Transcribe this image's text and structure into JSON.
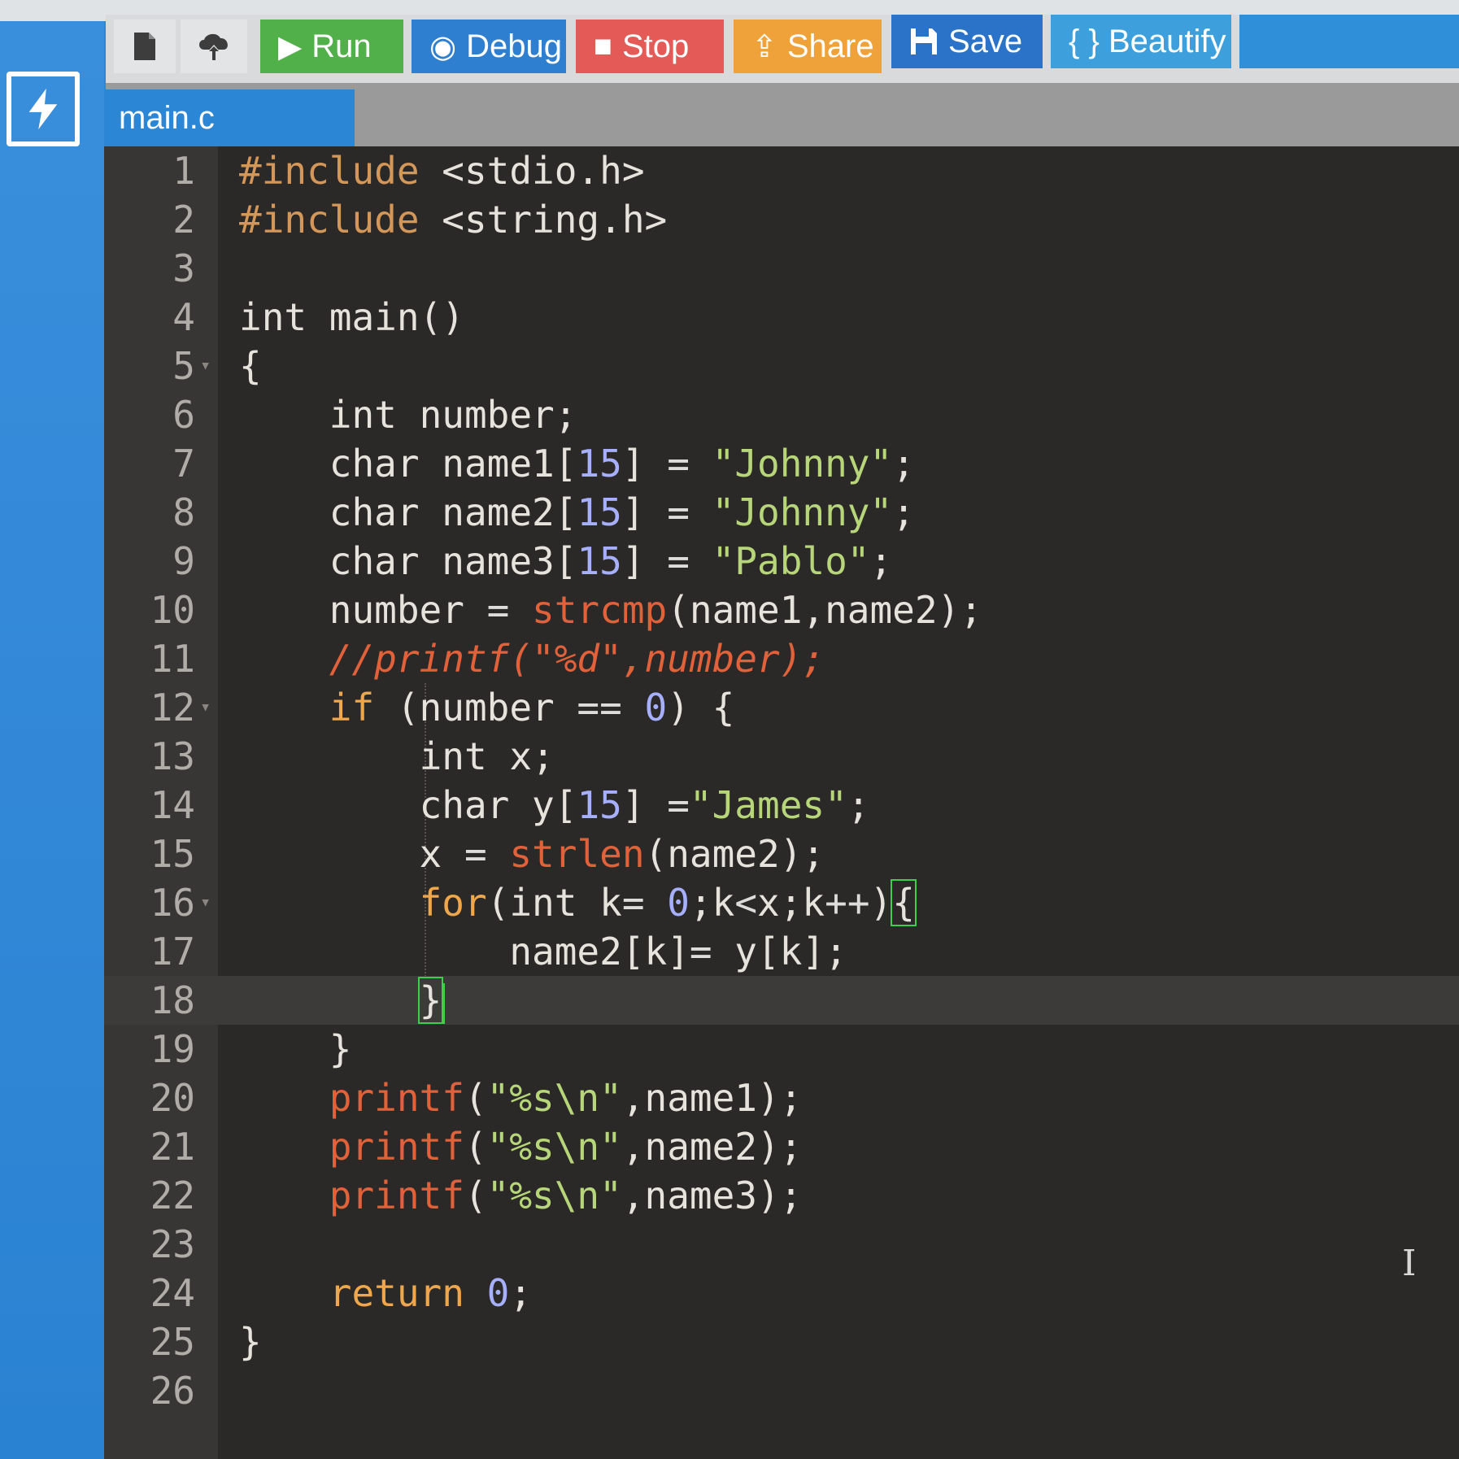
{
  "toolbar": {
    "new_file_icon": "file-icon",
    "upload_icon": "cloud-upload-icon",
    "run": {
      "label": "Run",
      "icon": "▶",
      "color": "#52b04a"
    },
    "debug": {
      "label": "Debug",
      "icon": "◉",
      "color": "#2f7fd0"
    },
    "stop": {
      "label": "Stop",
      "icon": "■",
      "color": "#e35a56"
    },
    "share": {
      "label": "Share",
      "icon": "⇪",
      "color": "#f0a23a"
    },
    "save": {
      "label": "Save",
      "icon": "💾",
      "color": "#2a73c8"
    },
    "beautify": {
      "label": "{ } Beautify",
      "color": "#3da0dd"
    }
  },
  "tabs": [
    {
      "label": "main.c"
    }
  ],
  "editor": {
    "lines": [
      "#include <stdio.h>",
      "#include <string.h>",
      "",
      "int main()",
      "{",
      "    int number;",
      "    char name1[15] = \"Johnny\";",
      "    char name2[15] = \"Johnny\";",
      "    char name3[15] = \"Pablo\";",
      "    number = strcmp(name1,name2);",
      "    //printf(\"%d\",number);",
      "    if (number == 0) {",
      "        int x;",
      "        char y[15] =\"James\";",
      "        x = strlen(name2);",
      "        for(int k= 0;k<x;k++){",
      "            name2[k]= y[k];",
      "        }",
      "    }",
      "    printf(\"%s\\n\",name1);",
      "    printf(\"%s\\n\",name2);",
      "    printf(\"%s\\n\",name3);",
      "",
      "    return 0;",
      "}",
      ""
    ],
    "active_line": 18
  }
}
